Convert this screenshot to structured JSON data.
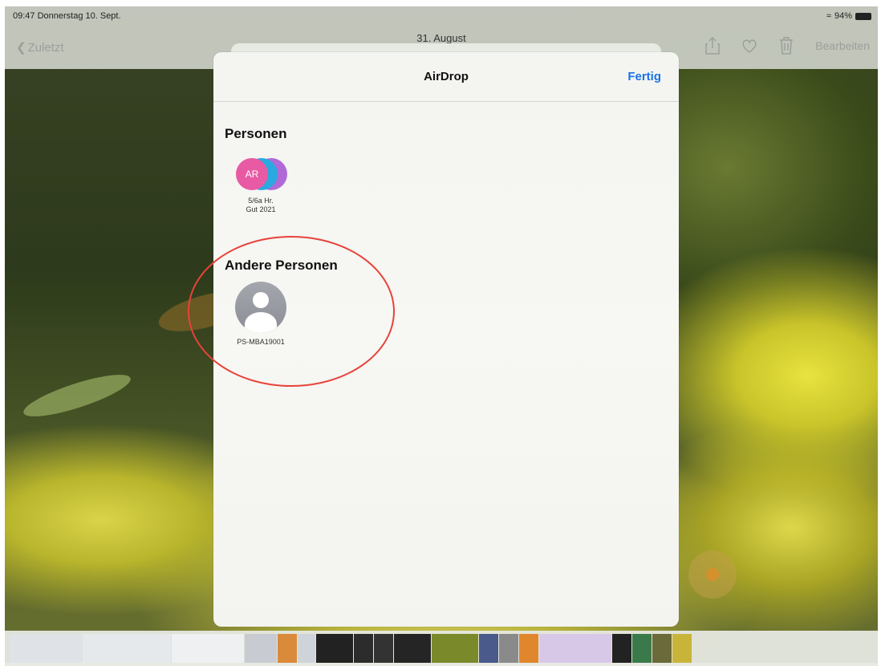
{
  "status_bar": {
    "time_date": "09:47  Donnerstag 10. Sept.",
    "battery": "94%"
  },
  "nav": {
    "back_label": "Zuletzt",
    "title": "31. August",
    "edit_label": "Bearbeiten",
    "icons": [
      "share-icon",
      "heart-icon",
      "trash-icon"
    ]
  },
  "sheet": {
    "title": "AirDrop",
    "done_label": "Fertig",
    "people_section": "Personen",
    "people": [
      {
        "initials": "AR",
        "label_line1": "5/6a Hr.",
        "label_line2": "Gut 2021"
      }
    ],
    "other_section": "Andere Personen",
    "others": [
      {
        "label": "PS-MBA19001"
      }
    ]
  },
  "colors": {
    "accent": "#1a73e8",
    "annotation": "#e8423a",
    "bubble_pink": "#e85aa3",
    "bubble_blue": "#2aa8e0",
    "bubble_purple": "#b06ad8"
  }
}
